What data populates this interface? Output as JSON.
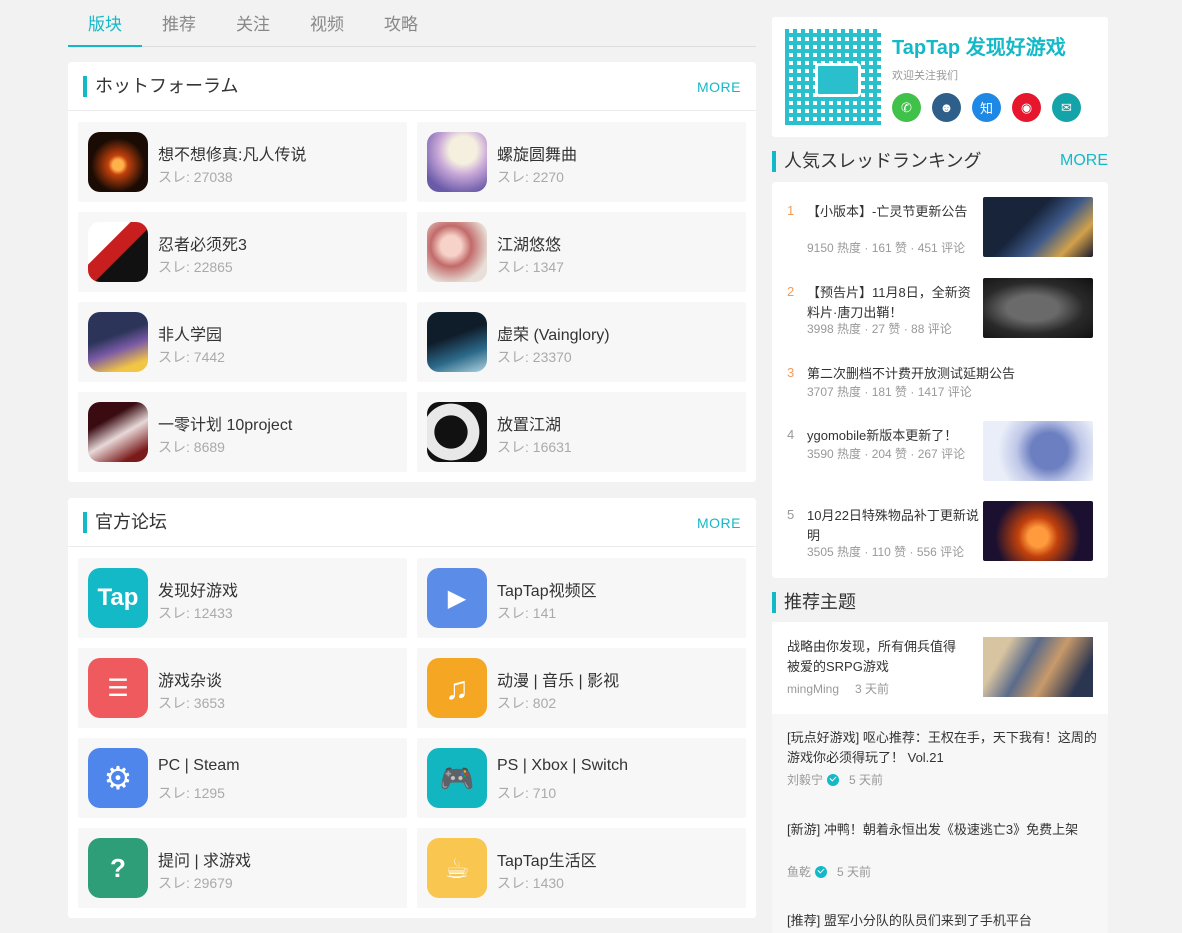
{
  "tabs": [
    {
      "label": "版块",
      "active": true
    },
    {
      "label": "推荐",
      "active": false
    },
    {
      "label": "关注",
      "active": false
    },
    {
      "label": "视频",
      "active": false
    },
    {
      "label": "攻略",
      "active": false
    }
  ],
  "hot_forum": {
    "title": "ホットフォーラム",
    "more": "MORE",
    "items": [
      {
        "name": "想不想修真:凡人传说",
        "count": "スレ: 27038",
        "icon": "game-icon"
      },
      {
        "name": "螺旋圆舞曲",
        "count": "スレ: 2270",
        "icon": "game-icon"
      },
      {
        "name": "忍者必须死3",
        "count": "スレ: 22865",
        "icon": "game-icon"
      },
      {
        "name": "江湖悠悠",
        "count": "スレ: 1347",
        "icon": "game-icon"
      },
      {
        "name": "非人学园",
        "count": "スレ: 7442",
        "icon": "game-icon"
      },
      {
        "name": "虚荣 (Vainglory)",
        "count": "スレ: 23370",
        "icon": "game-icon"
      },
      {
        "name": "一零计划 10project",
        "count": "スレ: 8689",
        "icon": "game-icon"
      },
      {
        "name": "放置江湖",
        "count": "スレ: 16631",
        "icon": "game-icon"
      }
    ]
  },
  "official_forum": {
    "title": "官方论坛",
    "more": "MORE",
    "items": [
      {
        "name": "发现好游戏",
        "count": "スレ: 12433",
        "icon": "taptap-icon",
        "glyph": "Tap"
      },
      {
        "name": "TapTap视频区",
        "count": "スレ: 141",
        "icon": "video-camera-icon",
        "glyph": "▶"
      },
      {
        "name": "游戏杂谈",
        "count": "スレ: 3653",
        "icon": "chat-bubbles-icon",
        "glyph": "☰"
      },
      {
        "name": "动漫 | 音乐 | 影视",
        "count": "スレ: 802",
        "icon": "music-note-icon",
        "glyph": "♫"
      },
      {
        "name": "PC | Steam",
        "count": "スレ: 1295",
        "icon": "steam-icon",
        "glyph": "⚙"
      },
      {
        "name": "PS | Xbox | Switch",
        "count": "スレ: 710",
        "icon": "gamepad-icon",
        "glyph": "🎮"
      },
      {
        "name": "提问 | 求游戏",
        "count": "スレ: 29679",
        "icon": "question-icon",
        "glyph": "?"
      },
      {
        "name": "TapTap生活区",
        "count": "スレ: 1430",
        "icon": "coffee-cup-icon",
        "glyph": "☕"
      }
    ]
  },
  "brand": {
    "name": "TapTap 发现好游戏",
    "follow_text": "欢迎关注我们",
    "socials": [
      {
        "name": "wechat-icon",
        "glyph": "✆",
        "color": "#3fc14a"
      },
      {
        "name": "qq-icon",
        "glyph": "☻",
        "color": "#2e5f8a"
      },
      {
        "name": "zhihu-icon",
        "glyph": "知",
        "color": "#1e88e5"
      },
      {
        "name": "weibo-icon",
        "glyph": "◉",
        "color": "#e6162d"
      },
      {
        "name": "mail-icon",
        "glyph": "✉",
        "color": "#14a3a8"
      }
    ]
  },
  "ranking": {
    "title": "人気スレッドランキング",
    "more": "MORE",
    "items": [
      {
        "rank": "1",
        "title": "【小版本】-亡灵节更新公告",
        "meta": "9150 热度 · 161 赞 · 451 评论"
      },
      {
        "rank": "2",
        "title": "【预告片】11月8日，全新资料片·唐刀出鞘！",
        "meta": "3998 热度 · 27 赞 · 88 评论"
      },
      {
        "rank": "3",
        "title": "第二次删档不计费开放测试延期公告",
        "meta": "3707 热度 · 181 赞 · 1417 评论"
      },
      {
        "rank": "4",
        "title": "ygomobile新版本更新了！",
        "meta": "3590 热度 · 204 赞 · 267 评论"
      },
      {
        "rank": "5",
        "title": "10月22日特殊物品补丁更新说明",
        "meta": "3505 热度 · 110 赞 · 556 评论"
      }
    ]
  },
  "recommend": {
    "title": "推荐主题",
    "items": [
      {
        "title": "战略由你发现，所有佣兵值得被爱的SRPG游戏",
        "author": "mingMing",
        "time": "3 天前"
      },
      {
        "title": "[玩点好游戏] 呕心推荐：王权在手，天下我有！这周的游戏你必须得玩了！ Vol.21",
        "author": "刘毅宁",
        "time": "5 天前"
      },
      {
        "title": "[新游] 冲鸭！朝着永恒出发《极速逃亡3》免费上架",
        "author": "鱼乾",
        "time": "5 天前"
      },
      {
        "title": "[推荐] 盟军小分队的队员们来到了手机平台",
        "author": "",
        "time": ""
      }
    ]
  },
  "colors": {
    "accent": "#14b9c8",
    "rank_top": "#f39c5a"
  }
}
